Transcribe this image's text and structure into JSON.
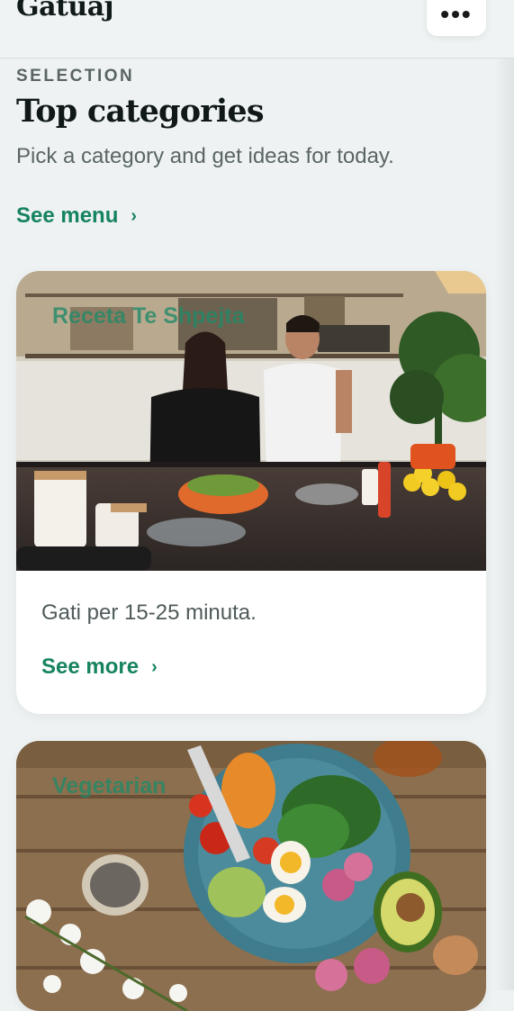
{
  "header": {
    "app_title": "Gatuaj",
    "menu_label": "•••"
  },
  "section": {
    "eyebrow": "SELECTION",
    "title": "Top categories",
    "subtitle": "Pick a category and get ideas for today.",
    "see_menu": "See menu"
  },
  "cards": [
    {
      "tag": "Receta Te Shpejta",
      "description": "Gati per 15-25 minuta.",
      "see_more": "See more"
    },
    {
      "tag": "Vegetarian"
    }
  ],
  "icons": {
    "chevron": "›"
  },
  "colors": {
    "accent": "#16835f",
    "background": "#eef2f2"
  }
}
